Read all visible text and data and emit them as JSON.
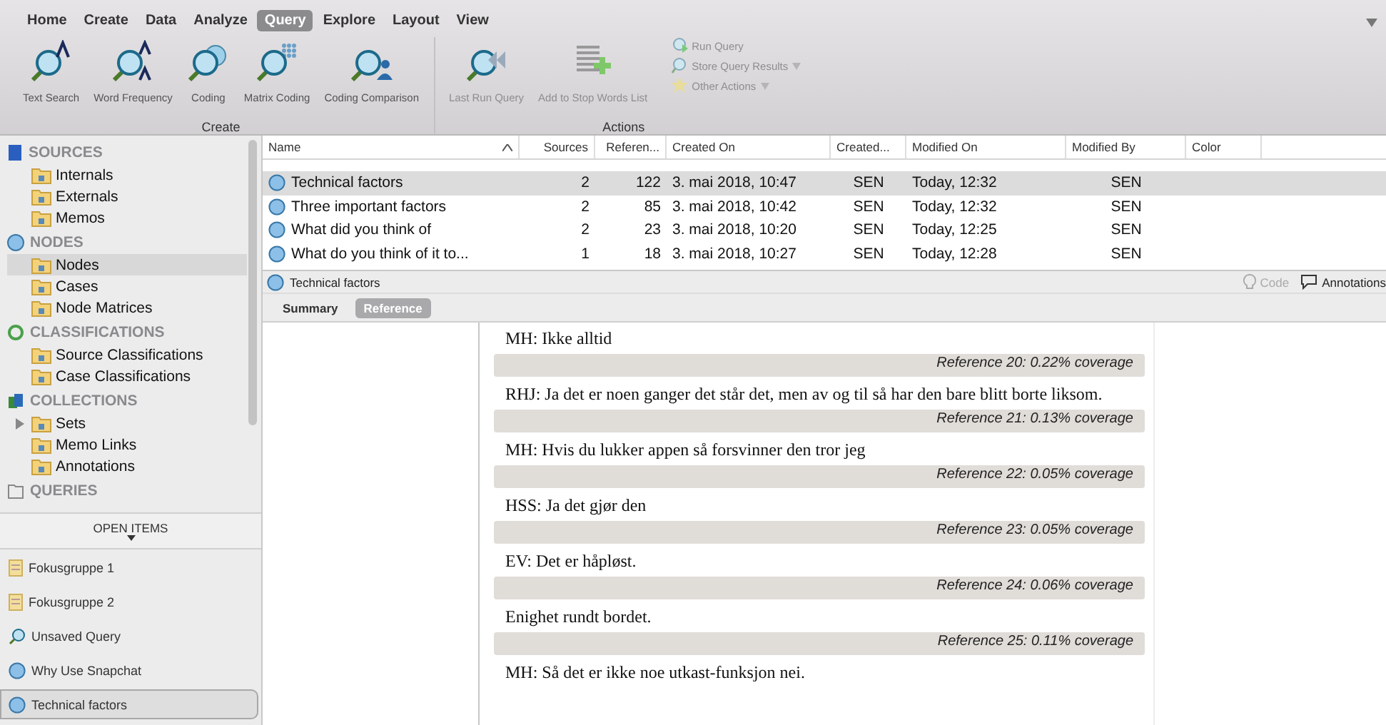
{
  "menu": [
    {
      "label": "Home",
      "selected": false
    },
    {
      "label": "Create",
      "selected": false
    },
    {
      "label": "Data",
      "selected": false
    },
    {
      "label": "Analyze",
      "selected": false
    },
    {
      "label": "Query",
      "selected": true
    },
    {
      "label": "Explore",
      "selected": false
    },
    {
      "label": "Layout",
      "selected": false
    },
    {
      "label": "View",
      "selected": false
    }
  ],
  "ribbon_groups": [
    {
      "title": "Create",
      "buttons": [
        {
          "label": "Text Search",
          "kind": "textsearch",
          "disabled": false
        },
        {
          "label": "Word Frequency",
          "kind": "wordfreq",
          "disabled": false
        },
        {
          "label": "Coding",
          "kind": "coding",
          "disabled": false
        },
        {
          "label": "Matrix Coding",
          "kind": "matrix",
          "disabled": false
        },
        {
          "label": "Coding Comparison",
          "kind": "comparison",
          "disabled": false
        }
      ]
    },
    {
      "title": "Actions",
      "buttons": [
        {
          "label": "Last Run Query",
          "kind": "lastrun",
          "disabled": true
        },
        {
          "label": "Add to Stop Words List",
          "kind": "stopwords",
          "disabled": true
        }
      ],
      "small": [
        {
          "label": "Run Query",
          "kind": "run",
          "dropdown": false
        },
        {
          "label": "Store Query Results",
          "kind": "store",
          "dropdown": true
        },
        {
          "label": "Other Actions",
          "kind": "star",
          "dropdown": true
        }
      ]
    }
  ],
  "sidebar": {
    "sections": [
      {
        "title": "SOURCES",
        "kind": "sources",
        "items": [
          {
            "label": "Internals",
            "selected": false
          },
          {
            "label": "Externals",
            "selected": false
          },
          {
            "label": "Memos",
            "selected": false
          }
        ]
      },
      {
        "title": "NODES",
        "kind": "nodes",
        "items": [
          {
            "label": "Nodes",
            "selected": true
          },
          {
            "label": "Cases",
            "selected": false
          },
          {
            "label": "Node Matrices",
            "selected": false
          }
        ]
      },
      {
        "title": "CLASSIFICATIONS",
        "kind": "classifications",
        "items": [
          {
            "label": "Source Classifications",
            "selected": false
          },
          {
            "label": "Case Classifications",
            "selected": false
          }
        ]
      },
      {
        "title": "COLLECTIONS",
        "kind": "collections",
        "items": [
          {
            "label": "Sets",
            "selected": false,
            "expanded": false
          },
          {
            "label": "Memo Links",
            "selected": false
          },
          {
            "label": "Annotations",
            "selected": false
          }
        ]
      },
      {
        "title": "QUERIES",
        "kind": "queries"
      }
    ],
    "open_items_title": "OPEN ITEMS",
    "open_items": [
      {
        "label": "Fokusgruppe 1",
        "kind": "document",
        "selected": false
      },
      {
        "label": "Fokusgruppe 2",
        "kind": "document",
        "selected": false
      },
      {
        "label": "Unsaved Query",
        "kind": "query",
        "selected": false
      },
      {
        "label": "Why Use Snapchat",
        "kind": "node",
        "selected": false
      },
      {
        "label": "Technical factors",
        "kind": "node",
        "selected": true
      }
    ]
  },
  "table": {
    "columns": [
      "Name",
      "Sources",
      "Referen...",
      "Created On",
      "Created...",
      "Modified On",
      "Modified By",
      "Color"
    ],
    "rows": [
      {
        "cells": [
          "Technical factors",
          "2",
          "122",
          "3. mai 2018, 10:47",
          "SEN",
          "Today, 12:32",
          "SEN"
        ],
        "selected": true
      },
      {
        "cells": [
          "Three important factors",
          "2",
          "85",
          "3. mai 2018, 10:42",
          "SEN",
          "Today, 12:32",
          "SEN"
        ],
        "selected": false
      },
      {
        "cells": [
          "What did you think of",
          "2",
          "23",
          "3. mai 2018, 10:20",
          "SEN",
          "Today, 12:25",
          "SEN"
        ],
        "selected": false
      },
      {
        "cells": [
          "What do you think of it to...",
          "1",
          "18",
          "3. mai 2018, 10:27",
          "SEN",
          "Today, 12:28",
          "SEN"
        ],
        "selected": false
      }
    ]
  },
  "detail": {
    "title": "Technical factors",
    "code": {
      "label": "Code",
      "disabled": true
    },
    "annotations": "Annotations",
    "tabs": [
      {
        "label": "Summary",
        "selected": false
      },
      {
        "label": "Reference",
        "selected": true
      }
    ],
    "document": [
      {
        "kind": "text",
        "text": "MH: Ikke alltid"
      },
      {
        "kind": "reference",
        "text": "Reference 20: 0.22% coverage"
      },
      {
        "kind": "text",
        "text": "RHJ: Ja det er noen ganger det står det, men av og til så har den bare blitt borte liksom."
      },
      {
        "kind": "reference",
        "text": "Reference 21: 0.13% coverage"
      },
      {
        "kind": "text",
        "text": "MH: Hvis du lukker appen så forsvinner den tror jeg"
      },
      {
        "kind": "reference",
        "text": "Reference 22: 0.05% coverage"
      },
      {
        "kind": "text",
        "text": "HSS: Ja det gjør den"
      },
      {
        "kind": "reference",
        "text": "Reference 23: 0.05% coverage"
      },
      {
        "kind": "text",
        "text": "EV: Det er håpløst."
      },
      {
        "kind": "reference",
        "text": "Reference 24: 0.06% coverage"
      },
      {
        "kind": "text",
        "text": "Enighet rundt bordet."
      },
      {
        "kind": "reference",
        "text": "Reference 25: 0.11% coverage"
      },
      {
        "kind": "text",
        "text": "MH: Så det er ikke noe utkast-funksjon nei."
      }
    ]
  }
}
